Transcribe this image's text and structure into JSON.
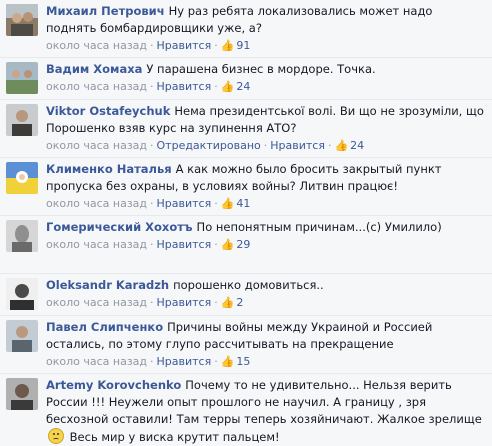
{
  "comments": [
    {
      "name": "Михаил Петрович",
      "text": "Ну раз ребята локализовались может надо поднять бомбардировщики уже, а?",
      "time": "около часа назад",
      "like_label": "Нравится",
      "likes": "91",
      "avatar_color": "#8a7a66"
    },
    {
      "name": "Вадим Хомаха",
      "text": "У парашена бизнес в мордоре. Точка.",
      "time": "около часа назад",
      "like_label": "Нравится",
      "likes": "24",
      "avatar_color": "#7f9a6e"
    },
    {
      "name": "Viktor Ostafeychuk",
      "text": "Нема президентської волі. Ви що не зрозуміли, що Порошенко взяв курс на зупинення АТО?",
      "time": "около часа назад",
      "edited": "Отредактировано",
      "like_label": "Нравится",
      "likes": "24",
      "avatar_color": "#6d6a63"
    },
    {
      "name": "Клименко Наталья",
      "text": "А как можно было бросить закрытый пункт пропуска без охраны, в условиях войны? Литвин працює!",
      "time": "около часа назад",
      "like_label": "Нравится",
      "likes": "41",
      "avatar_color": "#e9d36a"
    },
    {
      "name": "Гомерический Хохотъ",
      "text": "По непонятным причинам...(с) Умилило)",
      "time": "около часа назад",
      "like_label": "Нравится",
      "likes": "29",
      "avatar_color": "#9c9c9c"
    },
    {
      "name": "Oleksandr Karadzh",
      "text": "порошенко домовиться..",
      "time": "около часа назад",
      "like_label": "Нравится",
      "likes": "2",
      "avatar_color": "#505050"
    },
    {
      "name": "Павел Слипченко",
      "text": "Причины войны между Украиной и Россией остались, по этому глупо рассчитывать на прекращение",
      "time": "около часа назад",
      "like_label": "Нравится",
      "likes": "15",
      "avatar_color": "#7d8792"
    },
    {
      "name": "Artemy Korovchenko",
      "text_before": "Почему то не удивительно... Нельзя верить России !!! Неужели опыт прошлого не научил. А границу , зря бесхозной оставили! Там терры теперь хозяйничают. Жалкое зрелище",
      "text_after": "Весь мир у виска крутит пальцем!",
      "avatar_color": "#5a5a5a"
    }
  ]
}
